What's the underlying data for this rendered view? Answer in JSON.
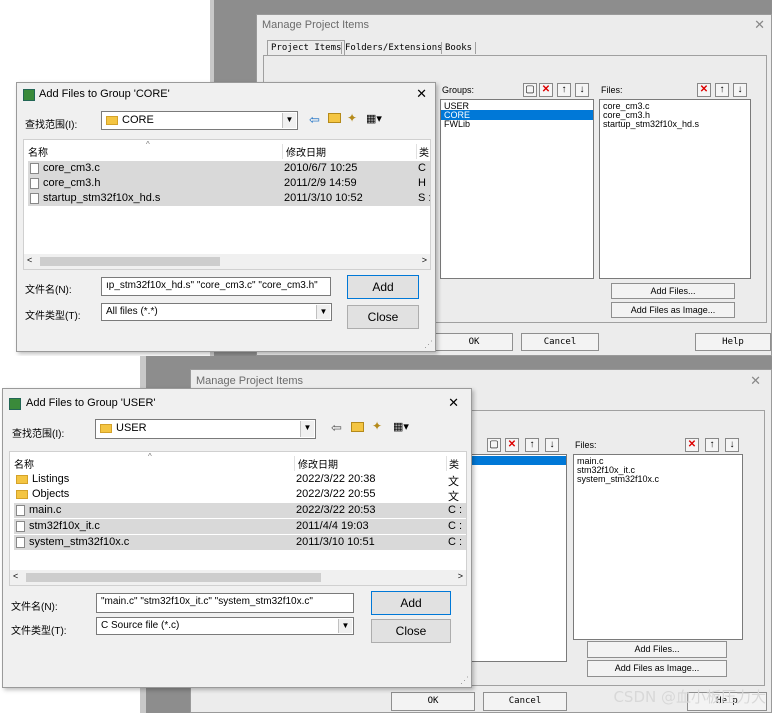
{
  "top": {
    "manage": {
      "title": "Manage Project Items",
      "tabs": [
        "Project Items",
        "Folders/Extensions",
        "Books"
      ],
      "groups_label": "Groups:",
      "files_label": "Files:",
      "groups": [
        "USER",
        "CORE",
        "FWLib"
      ],
      "selected_group": "CORE",
      "files": [
        "core_cm3.c",
        "core_cm3.h",
        "startup_stm32f10x_hd.s"
      ],
      "add_files": "Add Files...",
      "add_files_image": "Add Files as Image...",
      "ok": "OK",
      "cancel": "Cancel",
      "help": "Help"
    },
    "dialog": {
      "title": "Add Files to Group 'CORE'",
      "look_in_label": "查找范围(I):",
      "look_in_value": "CORE",
      "col_name": "名称",
      "col_date": "修改日期",
      "col_type": "类",
      "rows": [
        {
          "name": "core_cm3.c",
          "date": "2010/6/7 10:25",
          "type": "C :"
        },
        {
          "name": "core_cm3.h",
          "date": "2011/2/9 14:59",
          "type": "H :"
        },
        {
          "name": "startup_stm32f10x_hd.s",
          "date": "2011/3/10 10:52",
          "type": "S :"
        }
      ],
      "filename_label": "文件名(N):",
      "filename_value": "ıp_stm32f10x_hd.s\" \"core_cm3.c\" \"core_cm3.h\"",
      "filetype_label": "文件类型(T):",
      "filetype_value": "All files (*.*)",
      "add": "Add",
      "close": "Close"
    }
  },
  "bottom": {
    "manage": {
      "title": "Manage Project Items",
      "files_label": "Files:",
      "files": [
        "main.c",
        "stm32f10x_it.c",
        "system_stm32f10x.c"
      ],
      "add_files": "Add Files...",
      "add_files_image": "Add Files as Image...",
      "ok": "OK",
      "cancel": "Cancel",
      "help": "Help"
    },
    "dialog": {
      "title": "Add Files to Group 'USER'",
      "look_in_label": "查找范围(I):",
      "look_in_value": "USER",
      "col_name": "名称",
      "col_date": "修改日期",
      "col_type": "类",
      "rows": [
        {
          "name": "Listings",
          "date": "2022/3/22 20:38",
          "type": "文",
          "kind": "folder"
        },
        {
          "name": "Objects",
          "date": "2022/3/22 20:55",
          "type": "文",
          "kind": "folder"
        },
        {
          "name": "main.c",
          "date": "2022/3/22 20:53",
          "type": "C :",
          "kind": "file"
        },
        {
          "name": "stm32f10x_it.c",
          "date": "2011/4/4 19:03",
          "type": "C :",
          "kind": "file"
        },
        {
          "name": "system_stm32f10x.c",
          "date": "2011/3/10 10:51",
          "type": "C :",
          "kind": "file"
        }
      ],
      "filename_label": "文件名(N):",
      "filename_value": "\"main.c\" \"stm32f10x_it.c\" \"system_stm32f10x.c\"",
      "filetype_label": "文件类型(T):",
      "filetype_value": "C Source file (*.c)",
      "add": "Add",
      "close": "Close"
    }
  },
  "watermark": "CSDN @血小板压力大",
  "icons": [
    "close-icon",
    "new-folder-icon",
    "delete-icon",
    "up-arrow-icon",
    "down-arrow-icon",
    "back-arrow-icon",
    "folder-up-icon",
    "view-menu-icon",
    "keil-app-icon"
  ]
}
